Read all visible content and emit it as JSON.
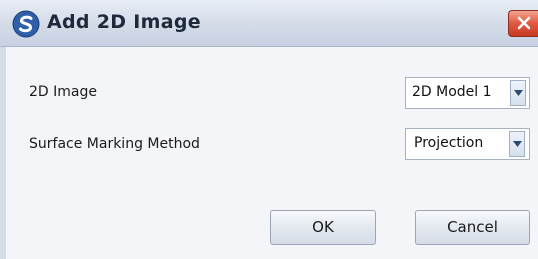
{
  "dialog": {
    "title": "Add 2D Image",
    "icons": {
      "app": "app-logo-icon",
      "close": "close-icon"
    }
  },
  "form": {
    "image": {
      "label": "2D Image",
      "value": "2D Model 1"
    },
    "method": {
      "label": "Surface Marking Method",
      "value": "Projection"
    }
  },
  "buttons": {
    "ok": "OK",
    "cancel": "Cancel"
  },
  "colors": {
    "close_button": "#d9472e",
    "app_icon": "#2e5fa8"
  }
}
